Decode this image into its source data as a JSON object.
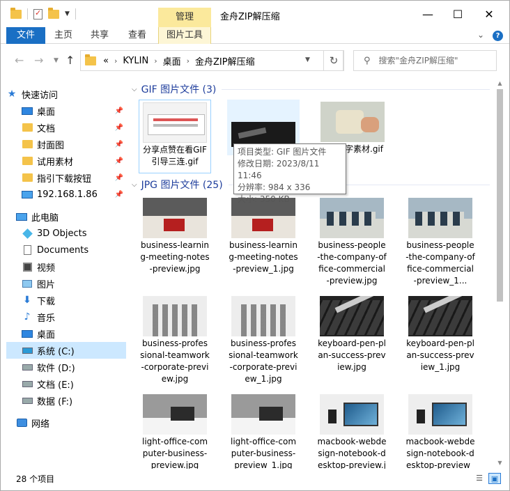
{
  "title_bar": {
    "title": "金舟ZIP解压缩",
    "contextual_tab_header": "管理",
    "minimize": "—",
    "maximize": "☐",
    "close": "✕"
  },
  "ribbon": {
    "tabs": [
      "文件",
      "主页",
      "共享",
      "查看",
      "图片工具"
    ],
    "help": "?"
  },
  "navigation": {
    "back": "←",
    "forward": "→",
    "up": "↑",
    "breadcrumb_prefix": "«",
    "breadcrumb": [
      "KYLIN",
      "桌面",
      "金舟ZIP解压缩"
    ],
    "refresh": "↻",
    "search_placeholder": "搜索\"金舟ZIP解压缩\""
  },
  "sidebar": {
    "quick_access": "快速访问",
    "quick_items": [
      "桌面",
      "文档",
      "封面图",
      "试用素材",
      "指引下载按钮",
      "192.168.1.86"
    ],
    "this_pc": "此电脑",
    "pc_items": [
      "3D Objects",
      "Documents",
      "视频",
      "图片",
      "下载",
      "音乐",
      "桌面",
      "系统 (C:)",
      "软件 (D:)",
      "文档 (E:)",
      "数据 (F:)"
    ],
    "selected_item": "系统 (C:)",
    "network": "网络"
  },
  "content": {
    "groups": [
      {
        "header": "GIF 图片文件 (3)",
        "files": [
          {
            "name": "分享点赞在看GIF引导三连.gif",
            "thumb": "th-gif1"
          },
          {
            "name": "",
            "thumb": "th-gif2"
          },
          {
            "name": "字素材.gif",
            "thumb": "th-gif3"
          }
        ]
      },
      {
        "header": "JPG 图片文件 (25)",
        "files": [
          {
            "name": "business-learning-meeting-notes-preview.jpg",
            "thumb": "th-meet"
          },
          {
            "name": "business-learning-meeting-notes-preview_1.jpg",
            "thumb": "th-meet"
          },
          {
            "name": "business-people-the-company-office-commercial-preview.jpg",
            "thumb": "th-office"
          },
          {
            "name": "business-people-the-company-office-commercial-preview_1...",
            "thumb": "th-office"
          },
          {
            "name": "business-professional-teamwork-corporate-preview.jpg",
            "thumb": "th-team"
          },
          {
            "name": "business-professional-teamwork-corporate-preview_1.jpg",
            "thumb": "th-team"
          },
          {
            "name": "keyboard-pen-plan-success-preview.jpg",
            "thumb": "th-key"
          },
          {
            "name": "keyboard-pen-plan-success-preview_1.jpg",
            "thumb": "th-key"
          },
          {
            "name": "light-office-computer-business-preview.jpg",
            "thumb": "th-light"
          },
          {
            "name": "light-office-computer-business-preview_1.jpg",
            "thumb": "th-light"
          },
          {
            "name": "macbook-webdesign-notebook-desktop-preview.jpg",
            "thumb": "th-mac"
          },
          {
            "name": "macbook-webdesign-notebook-desktop-preview_1.jpg",
            "thumb": "th-mac"
          }
        ]
      }
    ],
    "tooltip": {
      "type": "项目类型: GIF 图片文件",
      "modified": "修改日期: 2023/8/11 11:46",
      "resolution": "分辨率: 984 x 336",
      "size": "大小: 350 KB"
    }
  },
  "status_bar": {
    "item_count": "28 个项目"
  }
}
